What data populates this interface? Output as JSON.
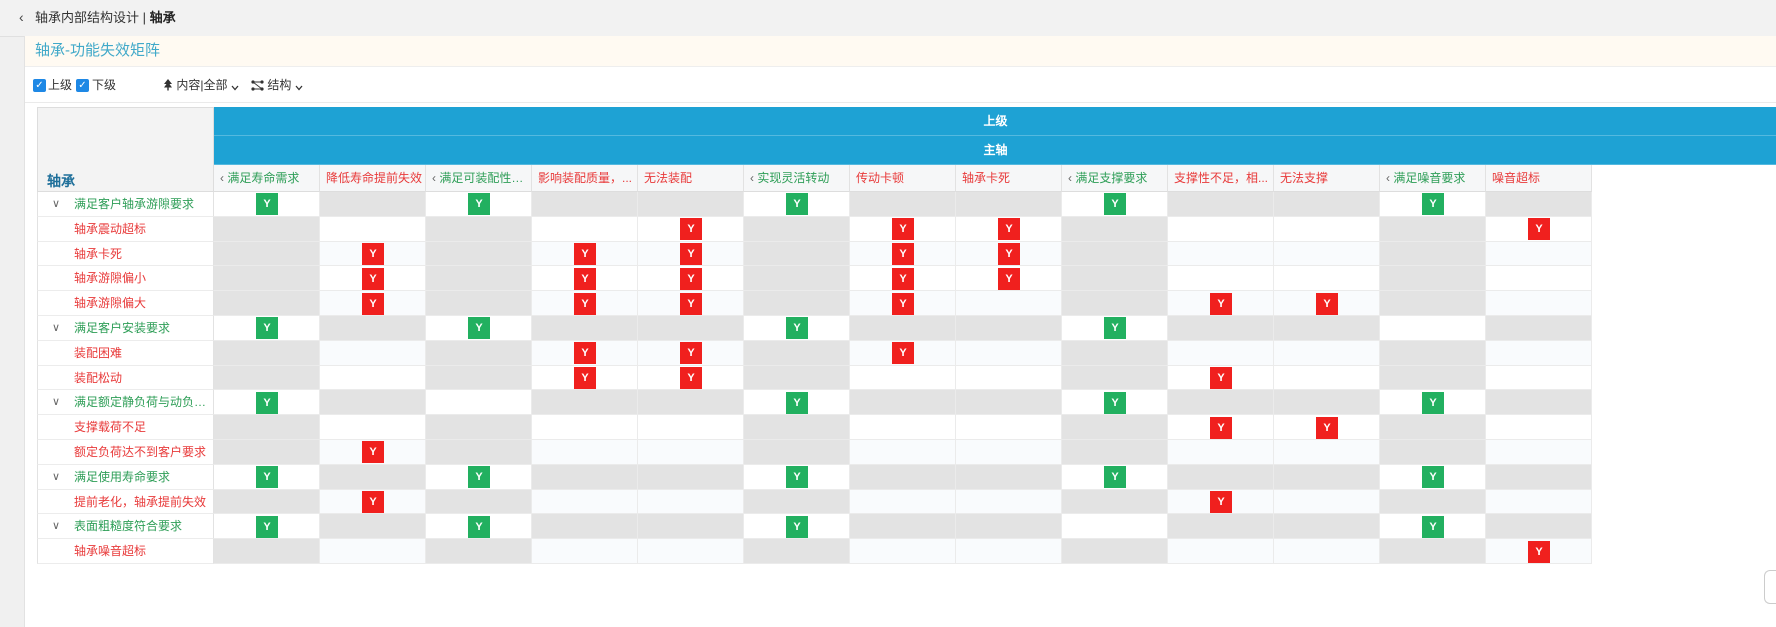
{
  "breadcrumb": {
    "parent": "轴承内部结构设计",
    "separator": " | ",
    "current": "轴承"
  },
  "page_title": "轴承-功能失效矩阵",
  "toolbar": {
    "upper_label": "上级",
    "lower_label": "下级",
    "content_filter": "内容|全部",
    "structure_label": "结构"
  },
  "matrix": {
    "corner_label": "轴承",
    "group_header": "上级",
    "sub_header": "主轴",
    "columns": [
      {
        "label": "满足寿命需求",
        "type": "func",
        "collapsible": true
      },
      {
        "label": "降低寿命提前失效",
        "type": "fail",
        "collapsible": false
      },
      {
        "label": "满足可装配性要求",
        "type": "func",
        "collapsible": true
      },
      {
        "label": "影响装配质量，...",
        "type": "fail",
        "collapsible": false
      },
      {
        "label": "无法装配",
        "type": "fail",
        "collapsible": false
      },
      {
        "label": "实现灵活转动",
        "type": "func",
        "collapsible": true
      },
      {
        "label": "传动卡顿",
        "type": "fail",
        "collapsible": false
      },
      {
        "label": "轴承卡死",
        "type": "fail",
        "collapsible": false
      },
      {
        "label": "满足支撑要求",
        "type": "func",
        "collapsible": true
      },
      {
        "label": "支撑性不足，相...",
        "type": "fail",
        "collapsible": false
      },
      {
        "label": "无法支撑",
        "type": "fail",
        "collapsible": false
      },
      {
        "label": "满足噪音要求",
        "type": "func",
        "collapsible": true
      },
      {
        "label": "噪音超标",
        "type": "fail",
        "collapsible": false
      }
    ],
    "rows": [
      {
        "label": "满足客户轴承游隙要求",
        "type": "func",
        "cells": [
          "G",
          "",
          "G",
          "",
          "",
          "G",
          "",
          "",
          "G",
          "",
          "",
          "G",
          ""
        ]
      },
      {
        "label": "轴承震动超标",
        "type": "fail",
        "cells": [
          "",
          "",
          "",
          "",
          "R",
          "",
          "R",
          "R",
          "",
          "",
          "",
          "",
          "R"
        ]
      },
      {
        "label": "轴承卡死",
        "type": "fail",
        "cells": [
          "",
          "R",
          "",
          "R",
          "R",
          "",
          "R",
          "R",
          "",
          "",
          "",
          "",
          ""
        ]
      },
      {
        "label": "轴承游隙偏小",
        "type": "fail",
        "cells": [
          "",
          "R",
          "",
          "R",
          "R",
          "",
          "R",
          "R",
          "",
          "",
          "",
          "",
          ""
        ]
      },
      {
        "label": "轴承游隙偏大",
        "type": "fail",
        "cells": [
          "",
          "R",
          "",
          "R",
          "R",
          "",
          "R",
          "",
          "",
          "R",
          "R",
          "",
          ""
        ]
      },
      {
        "label": "满足客户安装要求",
        "type": "func",
        "cells": [
          "G",
          "",
          "G",
          "",
          "",
          "G",
          "",
          "",
          "G",
          "",
          "",
          "",
          ""
        ]
      },
      {
        "label": "装配困难",
        "type": "fail",
        "cells": [
          "",
          "",
          "",
          "R",
          "R",
          "",
          "R",
          "",
          "",
          "",
          "",
          "",
          ""
        ]
      },
      {
        "label": "装配松动",
        "type": "fail",
        "cells": [
          "",
          "",
          "",
          "R",
          "R",
          "",
          "",
          "",
          "",
          "R",
          "",
          "",
          ""
        ]
      },
      {
        "label": "满足额定静负荷与动负荷要求",
        "type": "func",
        "cells": [
          "G",
          "",
          "",
          "",
          "",
          "G",
          "",
          "",
          "G",
          "",
          "",
          "G",
          ""
        ]
      },
      {
        "label": "支撑载荷不足",
        "type": "fail",
        "cells": [
          "",
          "",
          "",
          "",
          "",
          "",
          "",
          "",
          "",
          "R",
          "R",
          "",
          ""
        ]
      },
      {
        "label": "额定负荷达不到客户要求",
        "type": "fail",
        "cells": [
          "",
          "R",
          "",
          "",
          "",
          "",
          "",
          "",
          "",
          "",
          "",
          "",
          ""
        ]
      },
      {
        "label": "满足使用寿命要求",
        "type": "func",
        "cells": [
          "G",
          "",
          "G",
          "",
          "",
          "G",
          "",
          "",
          "G",
          "",
          "",
          "G",
          ""
        ]
      },
      {
        "label": "提前老化，轴承提前失效",
        "type": "fail",
        "cells": [
          "",
          "R",
          "",
          "",
          "",
          "",
          "",
          "",
          "",
          "R",
          "",
          "",
          ""
        ]
      },
      {
        "label": "表面粗糙度符合要求",
        "type": "func",
        "cells": [
          "G",
          "",
          "G",
          "",
          "",
          "G",
          "",
          "",
          "",
          "",
          "",
          "G",
          ""
        ]
      },
      {
        "label": "轴承噪音超标",
        "type": "fail",
        "cells": [
          "",
          "",
          "",
          "",
          "",
          "",
          "",
          "",
          "",
          "",
          "",
          "",
          "R"
        ]
      }
    ],
    "mark_text": "Y"
  },
  "colors": {
    "header_blue": "#1ea2d4",
    "green_mark": "#22b060",
    "red_mark": "#f0201e",
    "function_text": "#2e9e57",
    "failure_text": "#e83a3a",
    "title_color": "#41a9c9"
  }
}
